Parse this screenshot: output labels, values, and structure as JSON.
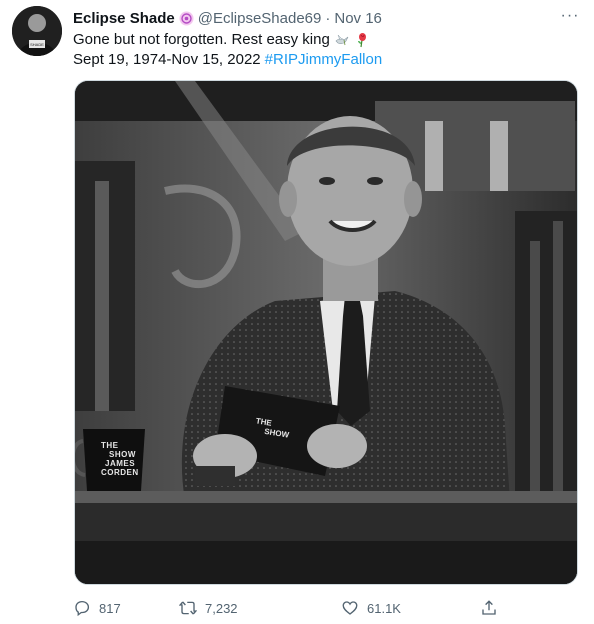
{
  "tweet": {
    "author": {
      "name": "Eclipse Shade",
      "handle": "@EclipseShade69",
      "date": "Nov 16"
    },
    "dot": "·",
    "more": "···",
    "text_line1": "Gone but not forgotten.  Rest easy king",
    "text_line2": "Sept 19, 1974-Nov 15, 2022",
    "hashtag": "#RIPJimmyFallon",
    "media": {
      "card_line1": "THE",
      "card_line2": "SHOW",
      "mug_line1": "THE",
      "mug_line2": "SHOW",
      "mug_line3": "JAMES",
      "mug_line4": "CORDEN"
    },
    "actions": {
      "reply_count": "817",
      "retweet_count": "7,232",
      "like_count": "61.1K"
    }
  },
  "icons": [
    "avatar-icon",
    "badge-icon",
    "more-icon",
    "dove-icon",
    "rose-icon",
    "reply-icon",
    "retweet-icon",
    "like-icon",
    "share-icon"
  ],
  "colors": {
    "hashtag": "#1d9bf0",
    "secondary_text": "#536471",
    "primary_text": "#0f1419",
    "border": "#cfd9de"
  }
}
